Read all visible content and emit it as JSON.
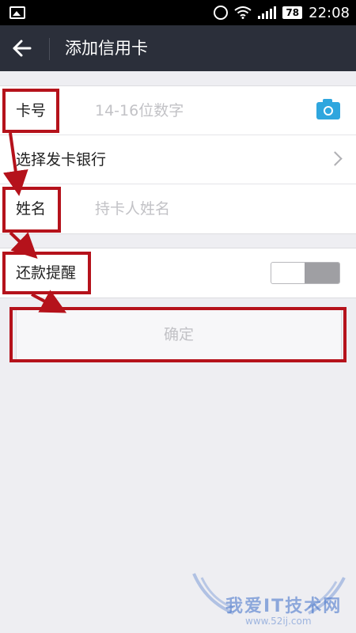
{
  "status_bar": {
    "battery": "78",
    "time": "22:08"
  },
  "app_bar": {
    "title": "添加信用卡"
  },
  "form": {
    "card_number": {
      "label": "卡号",
      "placeholder": "14-16位数字"
    },
    "bank": {
      "label": "选择发卡银行"
    },
    "name": {
      "label": "姓名",
      "placeholder": "持卡人姓名"
    }
  },
  "reminder": {
    "label": "还款提醒",
    "enabled": false
  },
  "confirm_label": "确定",
  "watermark": {
    "text": "我爱IT技术网",
    "url": "www.52ij.com"
  },
  "colors": {
    "accent": "#2fa6de",
    "highlight": "#b5121b",
    "app_bar": "#2b2f3a"
  }
}
